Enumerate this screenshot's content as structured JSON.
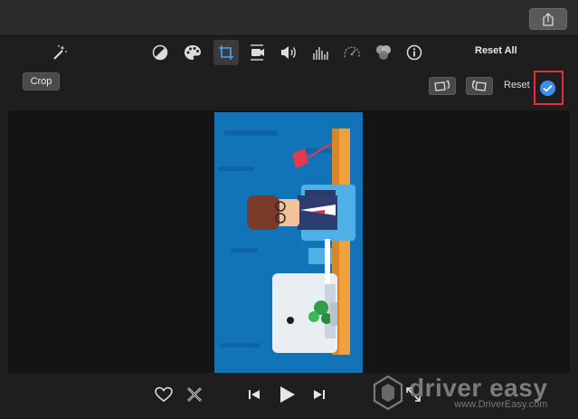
{
  "titlebar": {
    "share_icon": "share-icon"
  },
  "toolbar": {
    "reset_all_label": "Reset All",
    "tools": [
      "magic-wand-icon",
      "color-balance-icon",
      "palette-icon",
      "crop-icon",
      "stabilization-icon",
      "volume-icon",
      "equalizer-icon",
      "speed-icon",
      "filter-icon",
      "info-icon"
    ],
    "active_tool": "crop-icon"
  },
  "crop_bar": {
    "crop_label": "Crop",
    "reset_label": "Reset",
    "apply_icon": "checkmark-icon",
    "highlight_color": "#e0303a",
    "apply_color": "#3d8ef0"
  },
  "playback": {
    "icons": [
      "heart-icon",
      "reject-icon",
      "skip-back-icon",
      "play-icon",
      "skip-forward-icon",
      "fullscreen-icon"
    ]
  },
  "watermark": {
    "main": "driver easy",
    "sub": "www.DriverEasy.com"
  }
}
